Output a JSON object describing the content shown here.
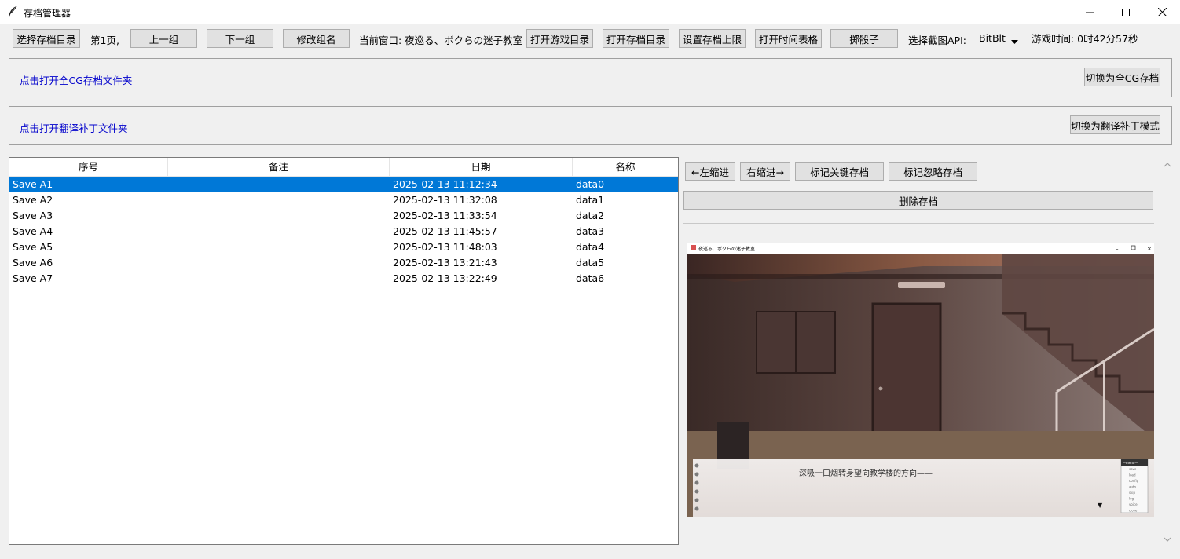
{
  "window": {
    "title": "存档管理器"
  },
  "toolbar": {
    "select_dir": "选择存档目录",
    "page_label": "第1页,",
    "prev_group": "上一组",
    "next_group": "下一组",
    "rename_group": "修改组名",
    "current_window": "当前窗口: 夜巡る、ボクらの迷子教室",
    "open_game_dir": "打开游戏目录",
    "open_save_dir": "打开存档目录",
    "set_save_limit": "设置存档上限",
    "open_timesheet": "打开时间表格",
    "roll_dice": "掷骰子",
    "screenshot_api_label": "选择截图API:",
    "screenshot_api_value": "BitBlt",
    "play_time": "游戏时间: 0时42分57秒"
  },
  "cg_panel": {
    "link": "点击打开全CG存档文件夹",
    "button": "切换为全CG存档"
  },
  "patch_panel": {
    "link": "点击打开翻译补丁文件夹",
    "button": "切换为翻译补丁模式"
  },
  "table": {
    "columns": [
      "序号",
      "备注",
      "日期",
      "名称"
    ],
    "rows": [
      {
        "id": "Save A1",
        "note": "",
        "date": "2025-02-13 11:12:34",
        "name": "data0"
      },
      {
        "id": "Save A2",
        "note": "",
        "date": "2025-02-13 11:32:08",
        "name": "data1"
      },
      {
        "id": "Save A3",
        "note": "",
        "date": "2025-02-13 11:33:54",
        "name": "data2"
      },
      {
        "id": "Save A4",
        "note": "",
        "date": "2025-02-13 11:45:57",
        "name": "data3"
      },
      {
        "id": "Save A5",
        "note": "",
        "date": "2025-02-13 11:48:03",
        "name": "data4"
      },
      {
        "id": "Save A6",
        "note": "",
        "date": "2025-02-13 13:21:43",
        "name": "data5"
      },
      {
        "id": "Save A7",
        "note": "",
        "date": "2025-02-13 13:22:49",
        "name": "data6"
      }
    ],
    "selected_index": 0
  },
  "actions": {
    "indent_left": "←左缩进",
    "indent_right": "右缩进→",
    "mark_key": "标记关键存档",
    "mark_ignore": "标记忽略存档",
    "delete": "删除存档"
  },
  "preview": {
    "window_title": "夜巡る、ボクらの迷子教室",
    "dialogue": "深吸一口烟转身望向教学楼的方向——",
    "menu_title": "—menu—",
    "menu_items": [
      "save",
      "load",
      "config",
      "auto",
      "skip",
      "log",
      "voice",
      "close"
    ]
  },
  "colors": {
    "selection": "#0078d7",
    "link": "#0000cc"
  }
}
